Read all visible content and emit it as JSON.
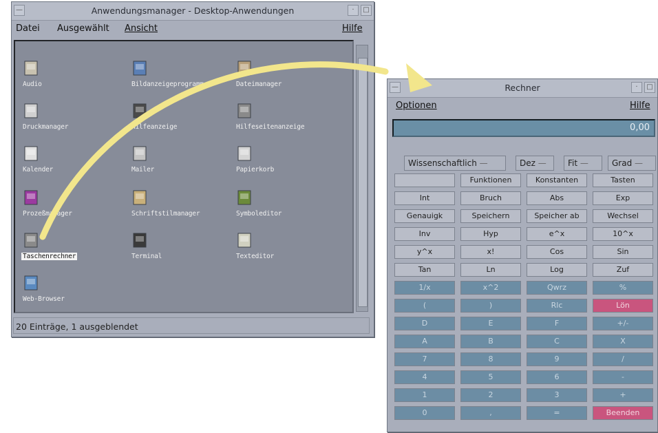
{
  "appman": {
    "title": "Anwendungsmanager - Desktop-Anwendungen",
    "menu": [
      "Datei",
      "Ausgewählt",
      "Ansicht"
    ],
    "help": "Hilfe",
    "icons": [
      {
        "label": "Audio",
        "icon": "audio-icon"
      },
      {
        "label": "Bildanzeigeprogramm",
        "icon": "image-viewer-icon"
      },
      {
        "label": "Dateimanager",
        "icon": "file-manager-icon"
      },
      {
        "label": "Druckmanager",
        "icon": "printer-icon"
      },
      {
        "label": "Hilfeanzeige",
        "icon": "help-viewer-icon"
      },
      {
        "label": "Hilfeseitenanzeige",
        "icon": "man-page-icon"
      },
      {
        "label": "Kalender",
        "icon": "calendar-icon"
      },
      {
        "label": "Mailer",
        "icon": "mailer-icon"
      },
      {
        "label": "Papierkorb",
        "icon": "trash-icon"
      },
      {
        "label": "Prozeßmanager",
        "icon": "process-manager-icon"
      },
      {
        "label": "Schriftstilmanager",
        "icon": "font-manager-icon"
      },
      {
        "label": "Symboleditor",
        "icon": "icon-editor-icon"
      },
      {
        "label": "Taschenrechner",
        "icon": "calculator-icon"
      },
      {
        "label": "Terminal",
        "icon": "terminal-icon"
      },
      {
        "label": "Texteditor",
        "icon": "text-editor-icon"
      },
      {
        "label": "Web-Browser",
        "icon": "web-browser-icon"
      }
    ],
    "status": "20 Einträge, 1 ausgeblendet"
  },
  "calc": {
    "title": "Rechner",
    "menu_options": "Optionen",
    "menu_help": "Hilfe",
    "display": "0,00",
    "modes": [
      "Wissenschaftlich",
      "Dez",
      "Fit",
      "Grad"
    ],
    "keys": [
      [
        "",
        "Funktionen",
        "Konstanten",
        "Tasten"
      ],
      [
        "Int",
        "Bruch",
        "Abs",
        "Exp"
      ],
      [
        "Genauigk",
        "Speichern",
        "Speicher ab",
        "Wechsel"
      ],
      [
        "Inv",
        "Hyp",
        "e^x",
        "10^x"
      ],
      [
        "y^x",
        "x!",
        "Cos",
        "Sin"
      ],
      [
        "Tan",
        "Ln",
        "Log",
        "Zuf"
      ],
      [
        "1/x",
        "x^2",
        "Qwrz",
        "%"
      ],
      [
        "(",
        ")",
        "Rlc",
        "Lön"
      ],
      [
        "D",
        "E",
        "F",
        "+/-"
      ],
      [
        "A",
        "B",
        "C",
        "X"
      ],
      [
        "7",
        "8",
        "9",
        "/"
      ],
      [
        "4",
        "5",
        "6",
        "-"
      ],
      [
        "1",
        "2",
        "3",
        "+"
      ],
      [
        "0",
        ",",
        "=",
        "Beenden"
      ]
    ],
    "colors": {
      "grey": "#b9bdc8",
      "blue": "#6c8da4",
      "pink": "#c9557e"
    }
  },
  "arrow_color": "#f2e68c"
}
